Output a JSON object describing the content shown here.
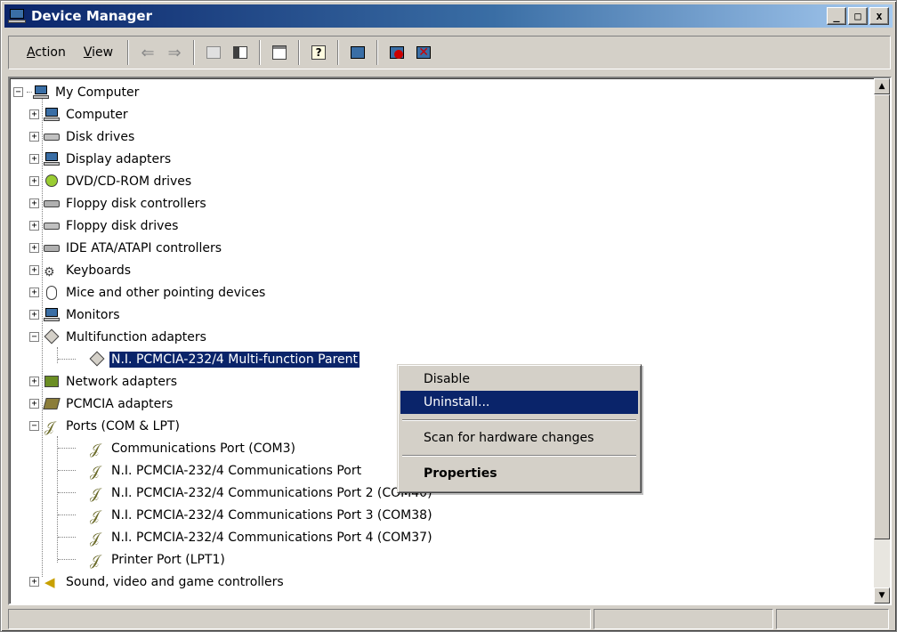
{
  "window": {
    "title": "Device Manager",
    "controls": {
      "minimize": "_",
      "maximize": "□",
      "close": "x"
    }
  },
  "menu": {
    "action": {
      "underline": "A",
      "rest": "ction"
    },
    "view": {
      "underline": "V",
      "rest": "iew"
    }
  },
  "toolbar": {
    "icons": [
      "back-arrow-icon",
      "forward-arrow-icon",
      "properties-sheet-icon",
      "show-hide-tree-icon",
      "properties-icon",
      "help-icon",
      "scan-hardware-icon",
      "disable-device-icon",
      "uninstall-device-icon"
    ]
  },
  "tree": {
    "root": "My Computer",
    "items": [
      {
        "label": "Computer",
        "icon": "computer-icon"
      },
      {
        "label": "Disk drives",
        "icon": "disk-drive-icon"
      },
      {
        "label": "Display adapters",
        "icon": "display-icon"
      },
      {
        "label": "DVD/CD-ROM drives",
        "icon": "dvd-icon"
      },
      {
        "label": "Floppy disk controllers",
        "icon": "controller-icon"
      },
      {
        "label": "Floppy disk drives",
        "icon": "floppy-icon"
      },
      {
        "label": "IDE ATA/ATAPI controllers",
        "icon": "controller-icon"
      },
      {
        "label": "Keyboards",
        "icon": "keyboard-icon"
      },
      {
        "label": "Mice and other pointing devices",
        "icon": "mouse-icon"
      },
      {
        "label": "Monitors",
        "icon": "monitor-icon"
      },
      {
        "label": "Multifunction adapters",
        "icon": "multifunction-icon"
      },
      {
        "label": "N.I. PCMCIA-232/4 Multi-function Parent",
        "icon": "multifunction-icon",
        "selected": true
      },
      {
        "label": "Network adapters",
        "icon": "network-icon"
      },
      {
        "label": "PCMCIA adapters",
        "icon": "pcmcia-icon"
      },
      {
        "label": "Ports (COM & LPT)",
        "icon": "port-icon"
      },
      {
        "label": "Communications Port (COM3)",
        "icon": "port-icon"
      },
      {
        "label": "N.I. PCMCIA-232/4 Communications Port",
        "icon": "port-icon"
      },
      {
        "label": "N.I. PCMCIA-232/4 Communications Port 2 (COM40)",
        "icon": "port-icon"
      },
      {
        "label": "N.I. PCMCIA-232/4 Communications Port 3 (COM38)",
        "icon": "port-icon"
      },
      {
        "label": "N.I. PCMCIA-232/4 Communications Port 4 (COM37)",
        "icon": "port-icon"
      },
      {
        "label": "Printer Port (LPT1)",
        "icon": "port-icon"
      },
      {
        "label": "Sound, video and game controllers",
        "icon": "sound-icon"
      }
    ]
  },
  "context_menu": {
    "disable": "Disable",
    "uninstall": "Uninstall...",
    "scan": "Scan for hardware changes",
    "properties": "Properties"
  },
  "colors": {
    "selection": "#0a246a",
    "window_face": "#d4d0c8"
  }
}
